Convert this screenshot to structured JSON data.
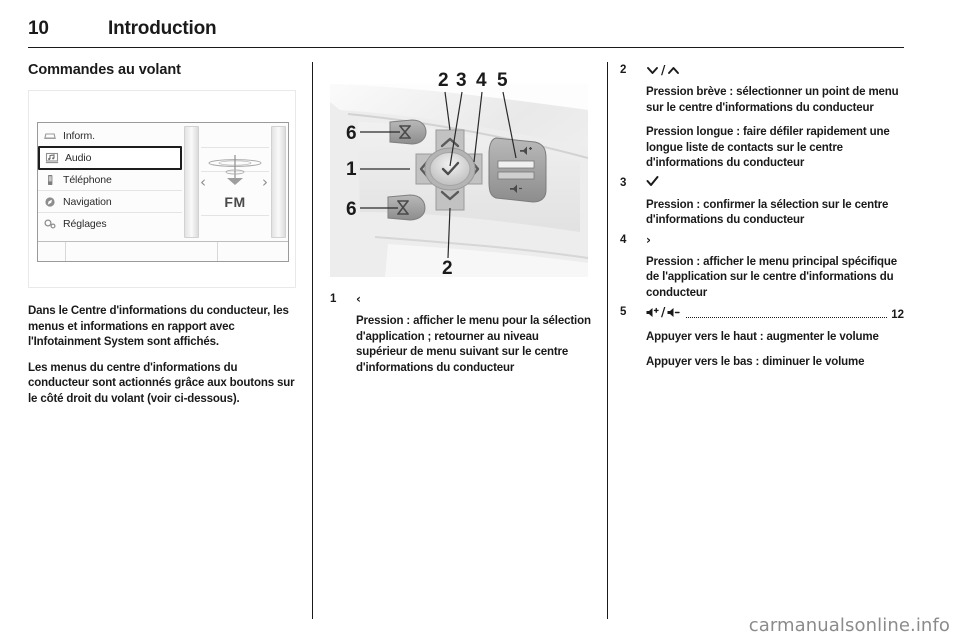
{
  "header": {
    "page_number": "10",
    "title": "Introduction"
  },
  "left_column": {
    "section_title": "Commandes au volant",
    "figure": {
      "name": "infotainment-display",
      "menu_items": [
        {
          "icon": "car-info-icon",
          "label": "Inform.",
          "selected": false
        },
        {
          "icon": "audio-note-icon",
          "label": "Audio",
          "selected": true
        },
        {
          "icon": "phone-icon",
          "label": "Téléphone",
          "selected": false
        },
        {
          "icon": "navigation-compass-icon",
          "label": "Navigation",
          "selected": false
        },
        {
          "icon": "settings-gears-icon",
          "label": "Réglages",
          "selected": false
        }
      ],
      "left_arrow": "‹",
      "right_arrow": "›",
      "band_label": "FM"
    },
    "paragraphs": [
      "Dans le Centre d'informations du conducteur, les menus et informations en rapport avec l'Infotainment System sont affichés.",
      "Les menus du centre d'informations du conducteur sont actionnés grâce aux boutons sur le côté droit du volant (voir ci-dessous)."
    ]
  },
  "middle_column": {
    "figure": {
      "name": "steering-wheel-controls",
      "callouts": [
        "1",
        "2",
        "3",
        "4",
        "5",
        "6",
        "6",
        "2"
      ]
    },
    "items": [
      {
        "number": "1",
        "symbol": "‹",
        "symbol_name": "chevron-left-icon",
        "paragraphs": [
          "Pression : afficher le menu pour la sélection d'application ; retourner au niveau supérieur de menu suivant sur le centre d'informations du conducteur"
        ]
      }
    ]
  },
  "right_column": {
    "items": [
      {
        "number": "2",
        "symbol_name": "chevron-down-up-icon",
        "symbol_parts": [
          "⌄",
          "/",
          "⌃"
        ],
        "paragraphs": [
          "Pression brève : sélectionner un point de menu sur le centre d'informations du conducteur",
          "Pression longue : faire défiler rapidement une longue liste de contacts sur le centre d'informations du conducteur"
        ]
      },
      {
        "number": "3",
        "symbol_name": "checkmark-icon",
        "symbol_parts": [
          "✓"
        ],
        "paragraphs": [
          "Pression : confirmer la sélection sur le centre d'informations du conducteur"
        ]
      },
      {
        "number": "4",
        "symbol_name": "chevron-right-icon",
        "symbol_parts": [
          "›"
        ],
        "paragraphs": [
          "Pression : afficher le menu principal spécifique de l'application sur le centre d'informations du conducteur"
        ]
      },
      {
        "number": "5",
        "symbol_name": "volume-up-down-icon",
        "symbol_parts": [
          "volume-up-icon",
          "/",
          "volume-down-icon"
        ],
        "page_ref": "12",
        "paragraphs": [
          "Appuyer vers le haut : augmenter le volume",
          "Appuyer vers le bas : diminuer le volume"
        ]
      }
    ]
  },
  "watermark": "carmanualsonline.info",
  "colors": {
    "ink": "#1a1a1a",
    "rule": "#1a1a1a",
    "watermark": "#8b8b8b"
  }
}
